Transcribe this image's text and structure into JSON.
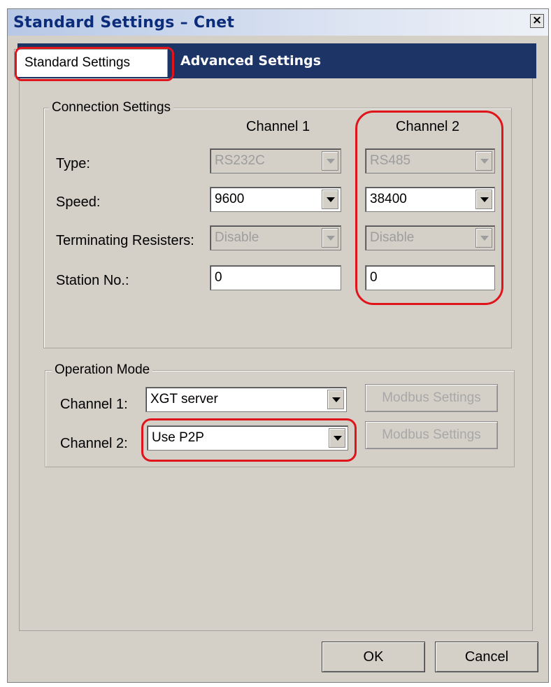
{
  "window": {
    "title": "Standard Settings – Cnet",
    "close_label": "×"
  },
  "tabs": [
    {
      "label": "Standard Settings",
      "selected": true
    },
    {
      "label": "Advanced Settings",
      "selected": false
    }
  ],
  "connection_settings": {
    "legend": "Connection Settings",
    "column_headers": [
      "Channel 1",
      "Channel 2"
    ],
    "rows": [
      {
        "label": "Type:",
        "ch1": "RS232C",
        "ch2": "RS485",
        "enabled": false
      },
      {
        "label": "Speed:",
        "ch1": "9600",
        "ch2": "38400",
        "enabled": true
      },
      {
        "label": "Terminating Resisters:",
        "ch1": "Disable",
        "ch2": "Disable",
        "enabled": false
      },
      {
        "label": "Station No.:",
        "ch1": "0",
        "ch2": "0",
        "enabled": true
      }
    ]
  },
  "operation_mode": {
    "legend": "Operation Mode",
    "channel1": {
      "label": "Channel 1:",
      "value": "XGT server",
      "button": "Modbus Settings"
    },
    "channel2": {
      "label": "Channel 2:",
      "value": "Use P2P",
      "button": "Modbus Settings"
    }
  },
  "buttons": {
    "ok": "OK",
    "cancel": "Cancel"
  },
  "colors": {
    "highlight": "#e0151b",
    "tab_bar": "#1c3566",
    "window_bg": "#d4d0c8"
  }
}
